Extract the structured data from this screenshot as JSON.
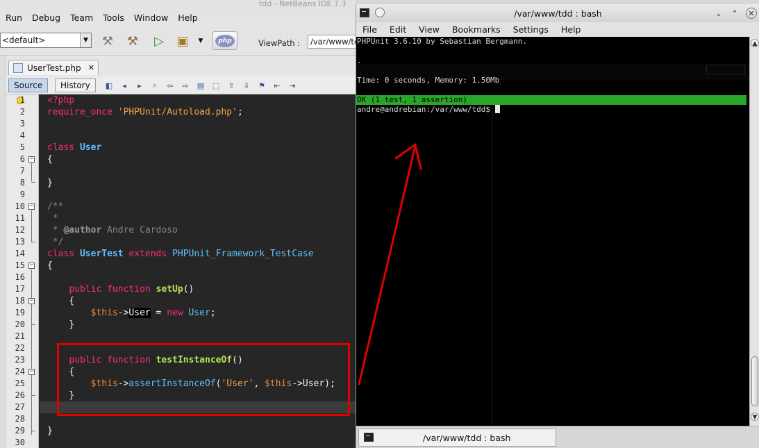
{
  "netbeans": {
    "title": "tdd - NetBeans IDE 7.3",
    "menu": [
      "Run",
      "Debug",
      "Team",
      "Tools",
      "Window",
      "Help"
    ],
    "config_value": "<default>",
    "php_badge": "php",
    "viewpath_label": "ViewPath :",
    "viewpath_value": "/var/www/td",
    "file_tab": "UserTest.php",
    "editor_tabs": [
      "Source",
      "History"
    ],
    "line_numbers": [
      "1",
      "2",
      "3",
      "4",
      "5",
      "6",
      "7",
      "8",
      "9",
      "10",
      "11",
      "12",
      "13",
      "14",
      "15",
      "16",
      "17",
      "18",
      "19",
      "20",
      "21",
      "22",
      "23",
      "24",
      "25",
      "26",
      "27",
      "28",
      "29",
      "30"
    ],
    "code": {
      "l1": "<?php",
      "l2_kw": "require_once",
      "l2_str": "'PHPUnit/Autoload.php'",
      "l2_end": ";",
      "l5_kw": "class",
      "l5_cls": "User",
      "brace_open": "{",
      "brace_close": "}",
      "l10": "/**",
      "l11": " *",
      "l12_a": " * ",
      "l12_tag": "@author",
      "l12_b": " Andre Cardoso",
      "l13": " */",
      "l14_kw": "class",
      "l14_cls": "UserTest",
      "l14_ext": "extends",
      "l14_parent": "PHPUnit_Framework_TestCase",
      "kw_public": "public",
      "kw_function": "function",
      "l17_fn": "setUp",
      "parens": "()",
      "var_this": "$this",
      "arrow": "->",
      "l19_prop": "User",
      "l19_eq": " = ",
      "l19_new": "new",
      "l19_cls": "User",
      "semi": ";",
      "l23_fn": "testInstanceOf",
      "l25_method": "assertInstanceOf",
      "l25_open": "(",
      "l25_str": "'User'",
      "l25_comma": ", ",
      "l25_prop": "User",
      "l25_close": ");"
    }
  },
  "konsole": {
    "title": "/var/www/tdd : bash",
    "menu": [
      "File",
      "Edit",
      "View",
      "Bookmarks",
      "Settings",
      "Help"
    ],
    "lines": {
      "version": "PHPUnit 3.6.10 by Sebastian Bergmann.",
      "dot": ".",
      "time": "Time: 0 seconds, Memory: 1.50Mb",
      "ok": "OK (1 test, 1 assertion)",
      "prompt": "andre@andrebian:/var/www/tdd$ "
    },
    "tab_label": "/var/www/tdd : bash",
    "colors": {
      "ok_bar": "#2aa52a",
      "background": "#000000"
    }
  },
  "annotation": {
    "box_color": "#e00000",
    "arrow_color": "#e00000"
  }
}
